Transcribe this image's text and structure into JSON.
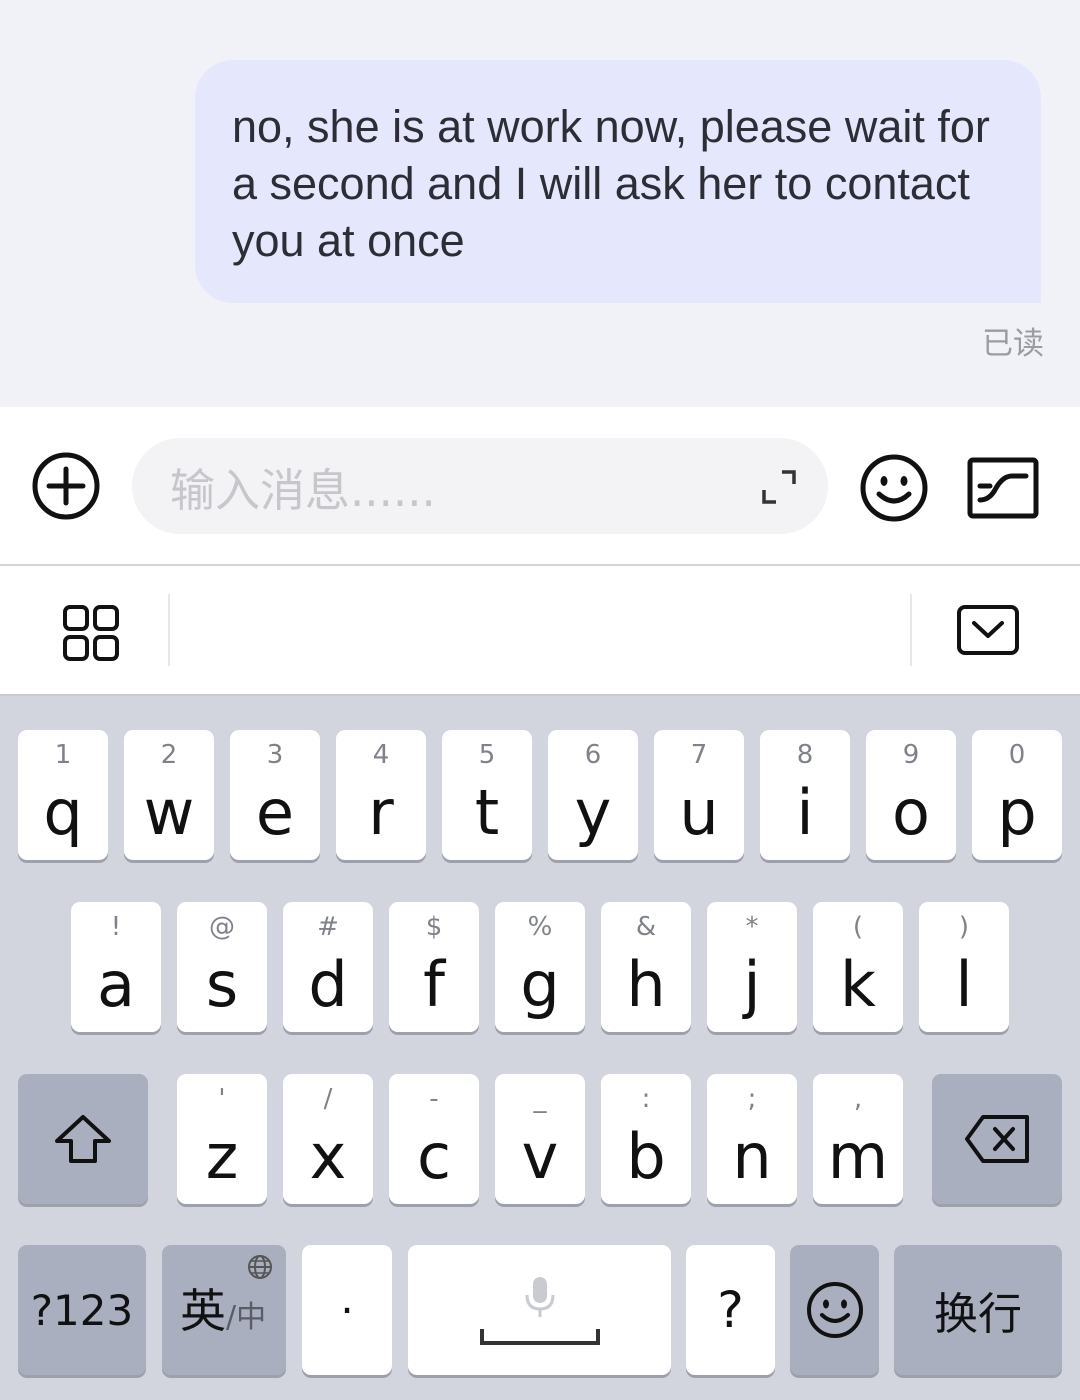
{
  "chat": {
    "message": "no, she is at work now, please wait for a second and I will ask her to contact you at once",
    "read_status": "已读"
  },
  "input": {
    "placeholder": "输入消息......"
  },
  "keyboard": {
    "row1": [
      {
        "hint": "1",
        "key": "q"
      },
      {
        "hint": "2",
        "key": "w"
      },
      {
        "hint": "3",
        "key": "e"
      },
      {
        "hint": "4",
        "key": "r"
      },
      {
        "hint": "5",
        "key": "t"
      },
      {
        "hint": "6",
        "key": "y"
      },
      {
        "hint": "7",
        "key": "u"
      },
      {
        "hint": "8",
        "key": "i"
      },
      {
        "hint": "9",
        "key": "o"
      },
      {
        "hint": "0",
        "key": "p"
      }
    ],
    "row2": [
      {
        "hint": "!",
        "key": "a"
      },
      {
        "hint": "@",
        "key": "s"
      },
      {
        "hint": "#",
        "key": "d"
      },
      {
        "hint": "$",
        "key": "f"
      },
      {
        "hint": "%",
        "key": "g"
      },
      {
        "hint": "&",
        "key": "h"
      },
      {
        "hint": "*",
        "key": "j"
      },
      {
        "hint": "(",
        "key": "k"
      },
      {
        "hint": ")",
        "key": "l"
      }
    ],
    "row3": [
      {
        "hint": "'",
        "key": "z"
      },
      {
        "hint": "/",
        "key": "x"
      },
      {
        "hint": "-",
        "key": "c"
      },
      {
        "hint": "_",
        "key": "v"
      },
      {
        "hint": ":",
        "key": "b"
      },
      {
        "hint": ";",
        "key": "n"
      },
      {
        "hint": ",",
        "key": "m"
      }
    ],
    "symbols_label": "?123",
    "lang_main": "英",
    "lang_sub": "/中",
    "dot": "·",
    "question": "?",
    "enter_label": "换行"
  },
  "colors": {
    "bubble": "#e5e7fd",
    "keyboard_bg": "#d2d5de",
    "key_dark": "#a9afbf"
  },
  "icons": {
    "attach": "plus-circle-icon",
    "expand": "expand-icon",
    "emoji": "smiley-icon",
    "sticker": "sticker-icon",
    "apps": "grid-icon",
    "hide_keyboard": "chevron-down-icon",
    "shift": "shift-arrow-icon",
    "backspace": "backspace-icon",
    "globe": "globe-icon",
    "mic": "microphone-icon"
  }
}
